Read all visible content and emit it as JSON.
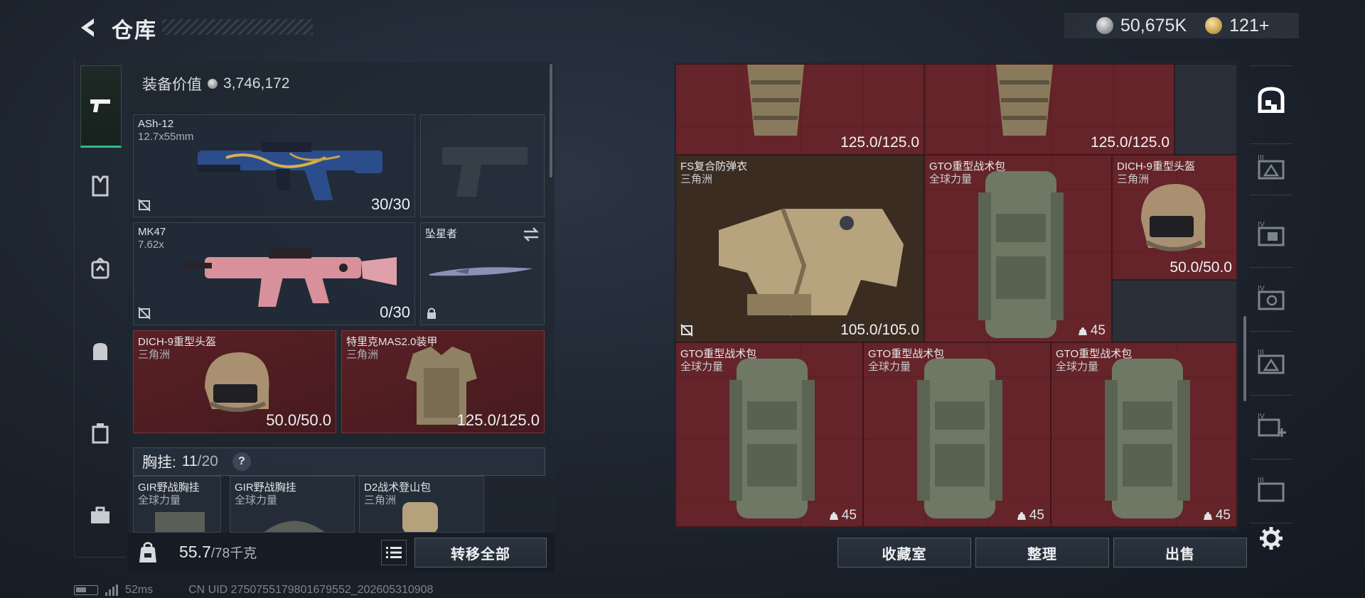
{
  "header": {
    "title": "仓库",
    "currency_silver": "50,675K",
    "currency_gold": "121+"
  },
  "left": {
    "equip_value_label": "装备价值",
    "equip_value": "3,746,172",
    "weapons": [
      {
        "name": "ASh-12",
        "ammo": "12.7x55mm",
        "value": "30/30"
      },
      {
        "name": "MK47",
        "ammo": "7.62x",
        "value": "0/30"
      }
    ],
    "melee": {
      "name": "坠星者"
    },
    "helmet": {
      "name": "DICH-9重型头盔",
      "sub": "三角洲",
      "value": "50.0/50.0"
    },
    "armor": {
      "name": "特里克MAS2.0装甲",
      "sub": "三角洲",
      "value": "125.0/125.0"
    },
    "rig": {
      "label": "胸挂:",
      "current": "11",
      "total": "/20",
      "help": "?"
    },
    "rig_items": [
      {
        "name": "GIR野战胸挂",
        "sub": "全球力量"
      },
      {
        "name": "GIR野战胸挂",
        "sub": "全球力量"
      },
      {
        "name": "D2战术登山包",
        "sub": "三角洲"
      }
    ],
    "weight": {
      "current": "55.7",
      "max": "/78",
      "unit": "千克"
    },
    "transfer_all": "转移全部"
  },
  "right": {
    "items": [
      {
        "value": "125.0/125.0"
      },
      {
        "value": "125.0/125.0"
      },
      {
        "name": "FS复合防弹衣",
        "sub": "三角洲",
        "value": "105.0/105.0"
      },
      {
        "name": "GTO重型战术包",
        "sub": "全球力量",
        "count": "45"
      },
      {
        "name": "DICH-9重型头盔",
        "sub": "三角洲",
        "value": "50.0/50.0"
      },
      {
        "name": "GTO重型战术包",
        "sub": "全球力量",
        "count": "45"
      },
      {
        "name": "GTO重型战术包",
        "sub": "全球力量",
        "count": "45"
      },
      {
        "name": "GTO重型战术包",
        "sub": "全球力量",
        "count": "45"
      }
    ],
    "buttons": {
      "collection": "收藏室",
      "organize": "整理",
      "sell": "出售"
    },
    "tab_labels": [
      "III",
      "IV",
      "IV",
      "III",
      "IV",
      "III"
    ]
  },
  "footer": {
    "ping": "52ms",
    "uid": "CN UID 2750755179801679552_202605310908"
  },
  "colors": {
    "accent": "#2dbb8c",
    "slot_red": "#5a2024"
  }
}
